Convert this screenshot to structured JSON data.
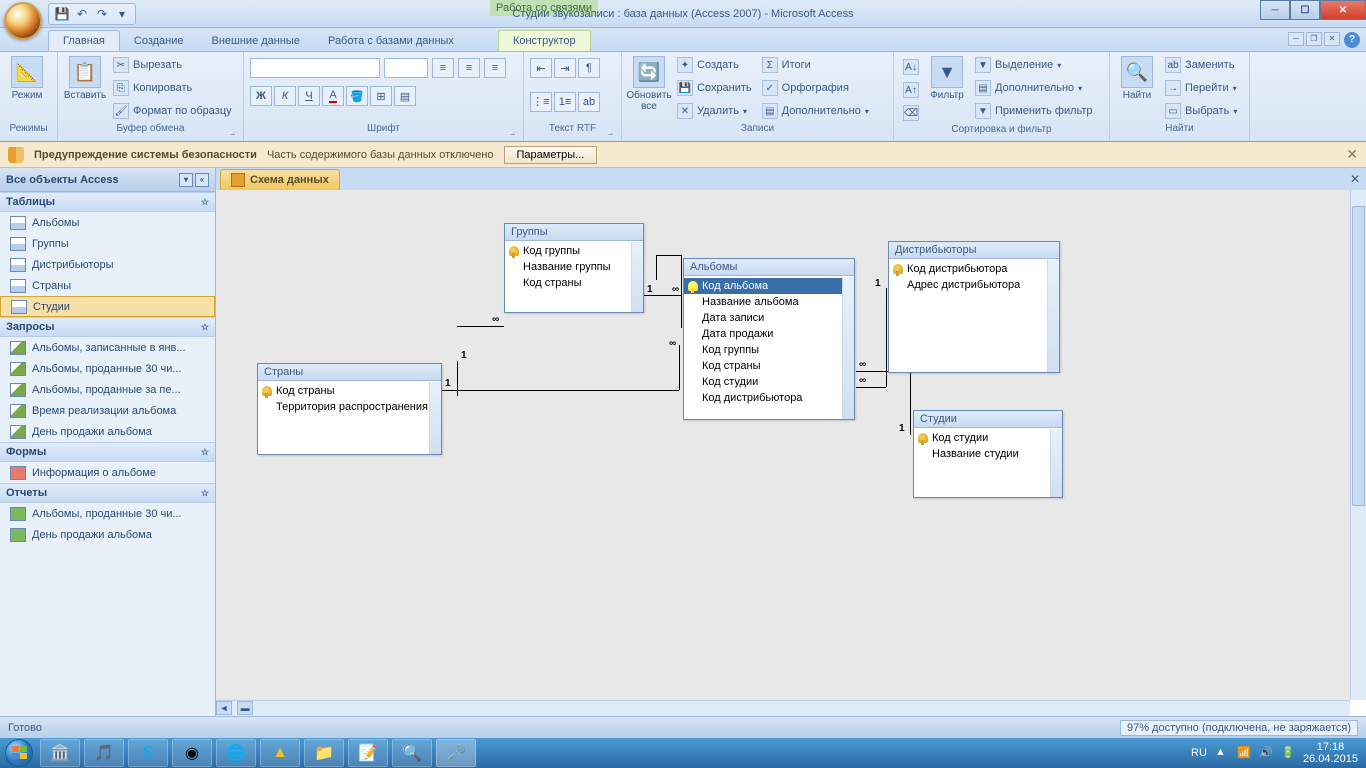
{
  "title": {
    "context_tab": "Работа со связями",
    "app": "Студии звукозаписи : база данных (Access 2007) - Microsoft Access"
  },
  "ribbon_tabs": [
    "Главная",
    "Создание",
    "Внешние данные",
    "Работа с базами данных",
    "Конструктор"
  ],
  "ribbon": {
    "modes": {
      "label": "Режимы",
      "btn": "Режим"
    },
    "clipboard": {
      "label": "Буфер обмена",
      "paste": "Вставить",
      "cut": "Вырезать",
      "copy": "Копировать",
      "format": "Формат по образцу"
    },
    "font": {
      "label": "Шрифт"
    },
    "rtf": {
      "label": "Текст RTF"
    },
    "records": {
      "label": "Записи",
      "refresh": "Обновить\nвсе",
      "new": "Создать",
      "save": "Сохранить",
      "delete": "Удалить",
      "totals": "Итоги",
      "spelling": "Орфография",
      "more": "Дополнительно"
    },
    "sort": {
      "label": "Сортировка и фильтр",
      "filter": "Фильтр",
      "selection": "Выделение",
      "advanced": "Дополнительно",
      "toggle": "Применить фильтр"
    },
    "find": {
      "label": "Найти",
      "find_btn": "Найти",
      "replace": "Заменить",
      "goto": "Перейти",
      "select": "Выбрать"
    }
  },
  "security": {
    "title": "Предупреждение системы безопасности",
    "msg": "Часть содержимого базы данных отключено",
    "btn": "Параметры..."
  },
  "nav": {
    "header": "Все объекты Access",
    "groups": [
      {
        "name": "Таблицы",
        "items": [
          {
            "icon": "table",
            "label": "Альбомы"
          },
          {
            "icon": "table",
            "label": "Группы"
          },
          {
            "icon": "table",
            "label": "Дистрибьюторы"
          },
          {
            "icon": "table",
            "label": "Страны"
          },
          {
            "icon": "table",
            "label": "Студии",
            "selected": true
          }
        ]
      },
      {
        "name": "Запросы",
        "items": [
          {
            "icon": "query",
            "label": "Альбомы, записанные в янв..."
          },
          {
            "icon": "query",
            "label": "Альбомы, проданные 30 чи..."
          },
          {
            "icon": "query",
            "label": "Альбомы, проданные за пе..."
          },
          {
            "icon": "query",
            "label": "Время реализации альбома"
          },
          {
            "icon": "query",
            "label": "День продажи альбома"
          }
        ]
      },
      {
        "name": "Формы",
        "items": [
          {
            "icon": "form",
            "label": "Информация о альбоме"
          }
        ]
      },
      {
        "name": "Отчеты",
        "items": [
          {
            "icon": "report",
            "label": "Альбомы, проданные 30 чи..."
          },
          {
            "icon": "report",
            "label": "День продажи альбома"
          }
        ]
      }
    ]
  },
  "doc_tab": "Схема данных",
  "diagram": {
    "groups": {
      "title": "Группы",
      "fields": [
        "Код группы",
        "Название группы",
        "Код страны"
      ]
    },
    "albums": {
      "title": "Альбомы",
      "fields": [
        "Код альбома",
        "Название альбома",
        "Дата записи",
        "Дата продажи",
        "Код группы",
        "Код страны",
        "Код студии",
        "Код дистрибьютора"
      ]
    },
    "distrib": {
      "title": "Дистрибьюторы",
      "fields": [
        "Код дистрибьютора",
        "Адрес дистрибьютора"
      ]
    },
    "countries": {
      "title": "Страны",
      "fields": [
        "Код страны",
        "Территория распространения"
      ]
    },
    "studios": {
      "title": "Студии",
      "fields": [
        "Код студии",
        "Название студии"
      ]
    }
  },
  "rel": {
    "one": "1",
    "many": "∞"
  },
  "status": {
    "ready": "Готово",
    "battery": "97% доступно (подключена, не заряжается)"
  },
  "tray": {
    "lang": "RU",
    "time": "17:18",
    "date": "26.04.2015"
  }
}
